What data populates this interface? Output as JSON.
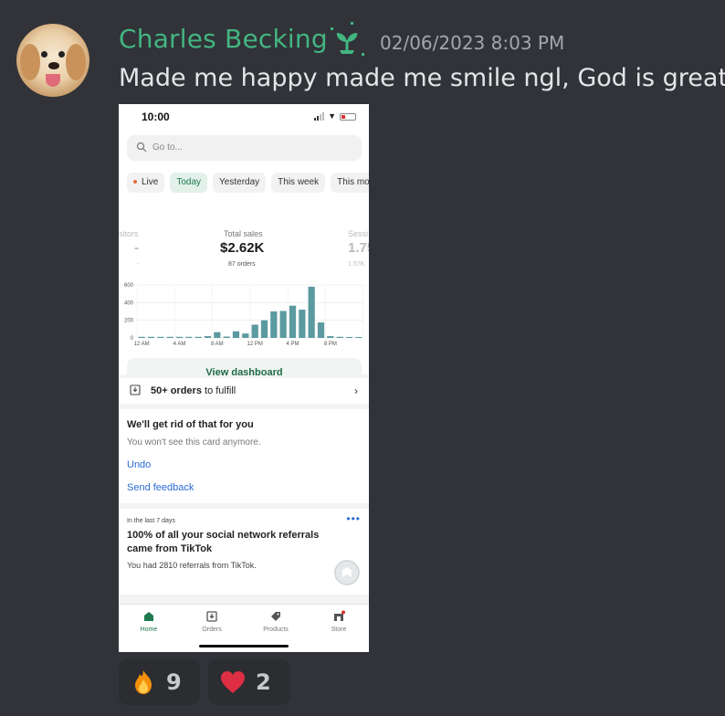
{
  "message": {
    "author": "Charles Becking",
    "timestamp": "02/06/2023 8:03 PM",
    "text": "Made me happy made me smile ngl, God is great."
  },
  "phone": {
    "status_time": "10:00",
    "search_placeholder": "Go to...",
    "tabs": [
      "Live",
      "Today",
      "Yesterday",
      "This week",
      "This mo"
    ],
    "metrics": {
      "left": {
        "label": "sitors",
        "value": "-",
        "sub": "-"
      },
      "center": {
        "label": "Total sales",
        "value": "$2.62K",
        "sub": "87 orders"
      },
      "right": {
        "label": "Sessi",
        "value": "1.75",
        "sub": "1.57K"
      }
    },
    "view_dashboard": "View dashboard",
    "fulfill": {
      "bold": "50+ orders",
      "rest": "to fulfill"
    },
    "dismiss_card": {
      "title": "We'll get rid of that for you",
      "subtitle": "You won't see this card anymore.",
      "undo": "Undo",
      "feedback": "Send feedback"
    },
    "insight_card": {
      "kicker": "In the last 7 days",
      "title": "100% of all your social network referrals came from TikTok",
      "body": "You had 2810 referrals from TikTok."
    },
    "tabbar": [
      "Home",
      "Orders",
      "Products",
      "Store"
    ]
  },
  "chart_data": {
    "type": "bar",
    "categories": [
      "12 AM",
      "1 AM",
      "2 AM",
      "3 AM",
      "4 AM",
      "5 AM",
      "6 AM",
      "7 AM",
      "8 AM",
      "9 AM",
      "10 AM",
      "11 AM",
      "12 PM",
      "1 PM",
      "2 PM",
      "3 PM",
      "4 PM",
      "5 PM",
      "6 PM",
      "7 PM",
      "8 PM",
      "9 PM",
      "10 PM",
      "11 PM"
    ],
    "values": [
      10,
      10,
      10,
      10,
      10,
      10,
      10,
      20,
      65,
      15,
      75,
      50,
      150,
      200,
      300,
      305,
      365,
      320,
      580,
      175,
      20,
      10,
      0,
      0
    ],
    "x_tick_labels": [
      "12 AM",
      "4 AM",
      "8 AM",
      "12 PM",
      "4 PM",
      "8 PM"
    ],
    "y_tick_labels": [
      "0",
      "200",
      "400",
      "600"
    ],
    "ylim": [
      0,
      600
    ],
    "grid": true,
    "bar_color": "#5b9aa0"
  },
  "reactions": [
    {
      "emoji": "fire",
      "count": "9"
    },
    {
      "emoji": "heart",
      "count": "2"
    }
  ],
  "colors": {
    "background": "#313338",
    "username": "#43b581",
    "accent_green": "#1e7a4d",
    "link_blue": "#2a6ad6"
  }
}
